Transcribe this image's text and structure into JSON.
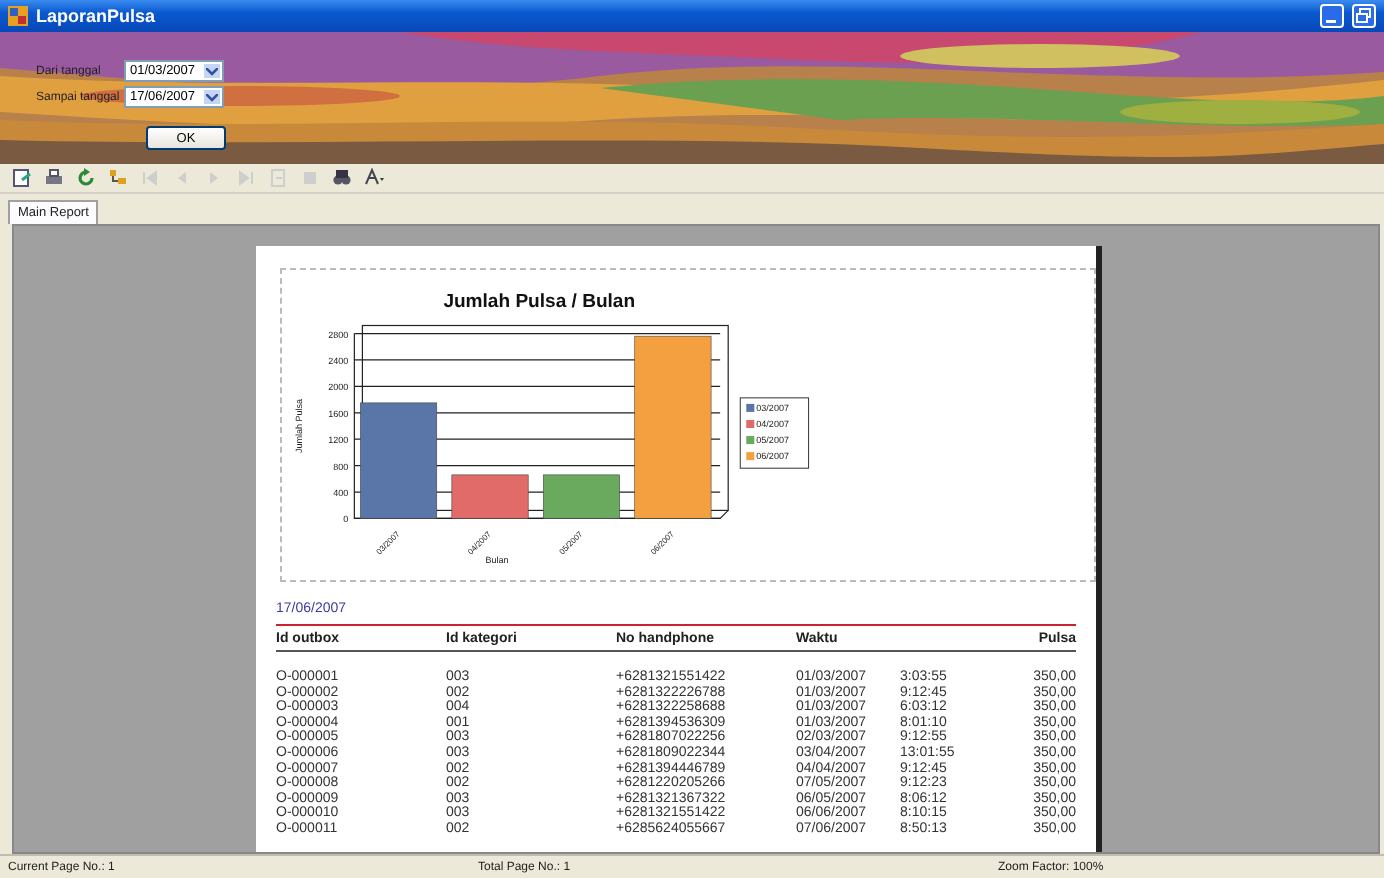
{
  "window": {
    "title": "LaporanPulsa"
  },
  "filter": {
    "fields": [
      {
        "label": "Dari tanggal",
        "value": "01/03/2007"
      },
      {
        "label": "Sampai tanggal",
        "value": "17/06/2007"
      }
    ],
    "button": "OK"
  },
  "toolbar": [
    {
      "kind": "export",
      "disabled": false
    },
    {
      "kind": "print",
      "disabled": false
    },
    {
      "kind": "refresh",
      "disabled": false
    },
    {
      "kind": "tree",
      "disabled": false
    },
    {
      "kind": "first",
      "disabled": true
    },
    {
      "kind": "prev",
      "disabled": true
    },
    {
      "kind": "next",
      "disabled": true
    },
    {
      "kind": "last",
      "disabled": true
    },
    {
      "kind": "goto",
      "disabled": true
    },
    {
      "kind": "stop",
      "disabled": true
    },
    {
      "kind": "search",
      "disabled": false
    },
    {
      "kind": "zoom",
      "disabled": false
    }
  ],
  "tabs": [
    {
      "label": "Main Report",
      "selected": true
    }
  ],
  "report": {
    "chart_data": {
      "type": "bar",
      "title": "Jumlah Pulsa / Bulan",
      "xlabel": "Bulan",
      "ylabel": "Jumlah Pulsa",
      "categories": [
        "03/2007",
        "04/2007",
        "05/2007",
        "06/2007"
      ],
      "ylim": [
        0,
        2800
      ],
      "grid": true,
      "legend": true,
      "yticks": [
        0,
        400,
        800,
        1200,
        1600,
        2000,
        2400,
        2800
      ],
      "series": [
        {
          "name": "03/2007",
          "color": "#5a76a8",
          "values": [
            1750,
            null,
            null,
            null
          ]
        },
        {
          "name": "04/2007",
          "color": "#e06b68",
          "values": [
            null,
            660,
            null,
            null
          ]
        },
        {
          "name": "05/2007",
          "color": "#6aaa5e",
          "values": [
            null,
            null,
            660,
            null
          ]
        },
        {
          "name": "06/2007",
          "color": "#f5a040",
          "values": [
            null,
            null,
            null,
            2760
          ]
        }
      ]
    },
    "date": "17/06/2007",
    "table": {
      "columns": [
        "Id outbox",
        "Id kategori",
        "No handphone",
        "Waktu",
        "Pulsa"
      ],
      "rows": [
        {
          "id_outbox": "O-000001",
          "id_kategori": "003",
          "no_handphone": "+6281321551422",
          "waktu_date": "01/03/2007",
          "waktu_time": "3:03:55",
          "pulsa": "350,00"
        },
        {
          "id_outbox": "O-000002",
          "id_kategori": "002",
          "no_handphone": "+6281322226788",
          "waktu_date": "01/03/2007",
          "waktu_time": "9:12:45",
          "pulsa": "350,00"
        },
        {
          "id_outbox": "O-000003",
          "id_kategori": "004",
          "no_handphone": "+6281322258688",
          "waktu_date": "01/03/2007",
          "waktu_time": "6:03:12",
          "pulsa": "350,00"
        },
        {
          "id_outbox": "O-000004",
          "id_kategori": "001",
          "no_handphone": "+6281394536309",
          "waktu_date": "01/03/2007",
          "waktu_time": "8:01:10",
          "pulsa": "350,00"
        },
        {
          "id_outbox": "O-000005",
          "id_kategori": "003",
          "no_handphone": "+6281807022256",
          "waktu_date": "02/03/2007",
          "waktu_time": "9:12:55",
          "pulsa": "350,00"
        },
        {
          "id_outbox": "O-000006",
          "id_kategori": "003",
          "no_handphone": "+6281809022344",
          "waktu_date": "03/04/2007",
          "waktu_time": "13:01:55",
          "pulsa": "350,00"
        },
        {
          "id_outbox": "O-000007",
          "id_kategori": "002",
          "no_handphone": "+6281394446789",
          "waktu_date": "04/04/2007",
          "waktu_time": "9:12:45",
          "pulsa": "350,00"
        },
        {
          "id_outbox": "O-000008",
          "id_kategori": "002",
          "no_handphone": "+6281220205266",
          "waktu_date": "07/05/2007",
          "waktu_time": "9:12:23",
          "pulsa": "350,00"
        },
        {
          "id_outbox": "O-000009",
          "id_kategori": "003",
          "no_handphone": "+6281321367322",
          "waktu_date": "06/05/2007",
          "waktu_time": "8:06:12",
          "pulsa": "350,00"
        },
        {
          "id_outbox": "O-000010",
          "id_kategori": "003",
          "no_handphone": "+6281321551422",
          "waktu_date": "06/06/2007",
          "waktu_time": "8:10:15",
          "pulsa": "350,00"
        },
        {
          "id_outbox": "O-000011",
          "id_kategori": "002",
          "no_handphone": "+6285624055667",
          "waktu_date": "07/06/2007",
          "waktu_time": "8:50:13",
          "pulsa": "350,00"
        }
      ]
    }
  },
  "status_bar": {
    "current_page": "Current Page No.: 1",
    "total_page": "Total Page No.: 1",
    "zoom": "Zoom Factor: 100%"
  }
}
